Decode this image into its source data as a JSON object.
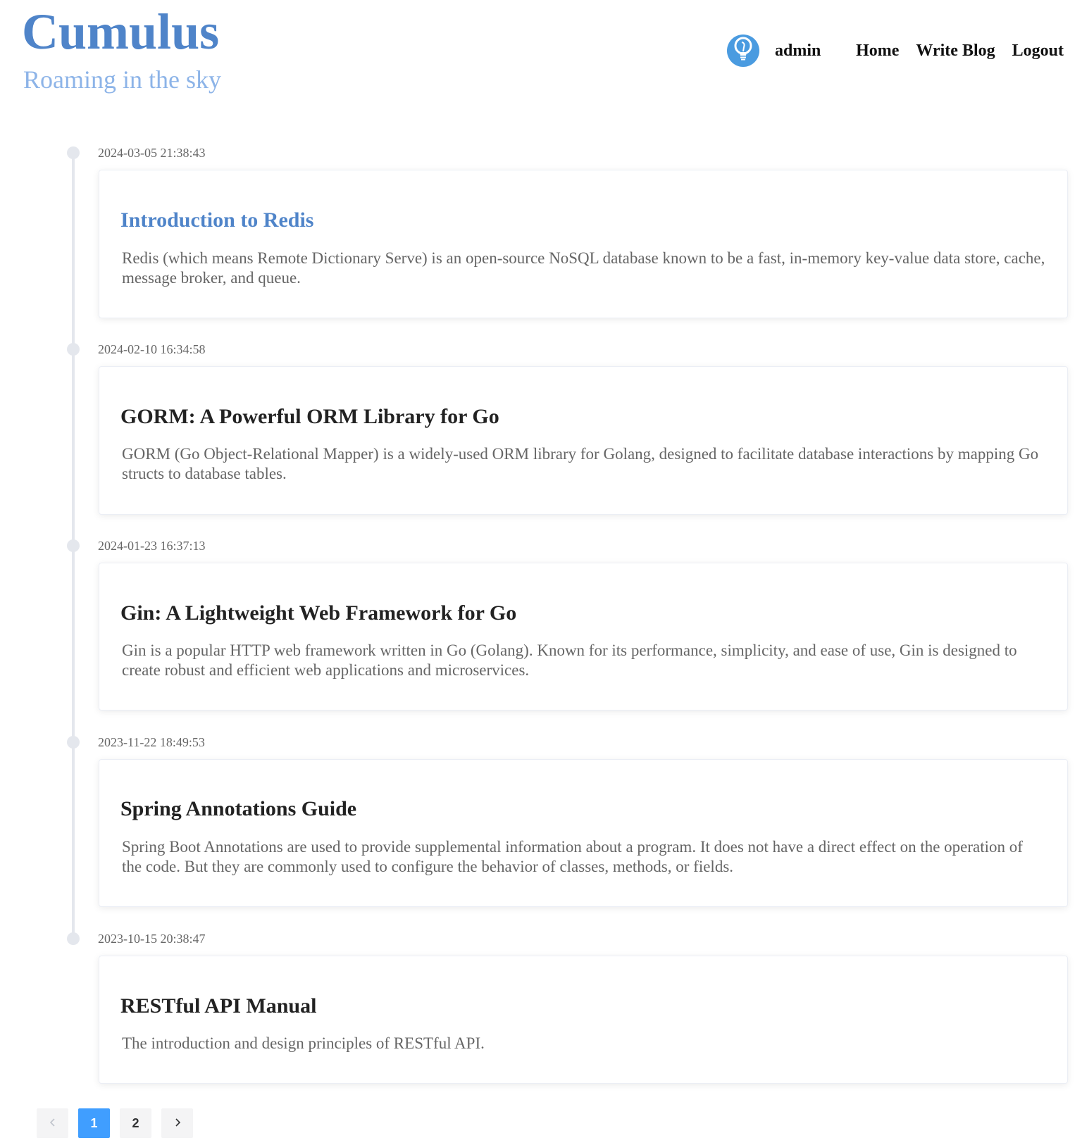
{
  "header": {
    "site_title": "Cumulus",
    "site_subtitle": "Roaming in the sky",
    "avatar_icon": "lightbulb-icon",
    "username": "admin",
    "nav": {
      "home": "Home",
      "write_blog": "Write Blog",
      "logout": "Logout"
    }
  },
  "posts": [
    {
      "timestamp": "2024-03-05 21:38:43",
      "title": "Introduction to Redis",
      "excerpt": "Redis (which means Remote Dictionary Serve) is an open-source NoSQL database known to be a fast, in-memory key-value data store, cache, message broker, and queue."
    },
    {
      "timestamp": "2024-02-10 16:34:58",
      "title": "GORM: A Powerful ORM Library for Go",
      "excerpt": "GORM (Go Object-Relational Mapper) is a widely-used ORM library for Golang, designed to facilitate database interactions by mapping Go structs to database tables."
    },
    {
      "timestamp": "2024-01-23 16:37:13",
      "title": "Gin: A Lightweight Web Framework for Go",
      "excerpt": "Gin is a popular HTTP web framework written in Go (Golang). Known for its performance, simplicity, and ease of use, Gin is designed to create robust and efficient web applications and microservices."
    },
    {
      "timestamp": "2023-11-22 18:49:53",
      "title": "Spring Annotations Guide",
      "excerpt": "Spring Boot Annotations are used to provide supplemental information about a program. It does not have a direct effect on the operation of the code. But they are commonly used to configure the behavior of classes, methods, or fields."
    },
    {
      "timestamp": "2023-10-15 20:38:47",
      "title": "RESTful API Manual",
      "excerpt": "The introduction and design principles of RESTful API."
    }
  ],
  "pagination": {
    "prev_icon": "chevron-left-icon",
    "next_icon": "chevron-right-icon",
    "pages": [
      "1",
      "2"
    ],
    "current_page": "1"
  },
  "colors": {
    "brand": "#4f84c9",
    "subtitle": "#8db4e8",
    "active_page": "#409eff",
    "timeline": "#e4e7ed"
  }
}
